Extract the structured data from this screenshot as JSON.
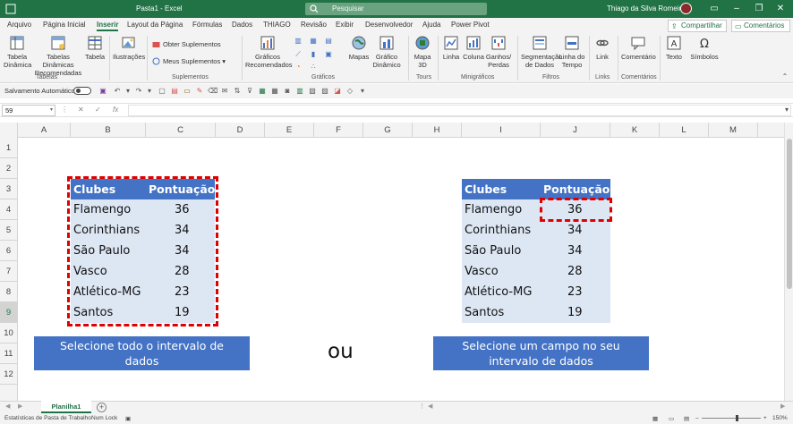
{
  "titlebar": {
    "doc_title": "Pasta1 - Excel",
    "search_placeholder": "Pesquisar",
    "user_name": "Thiago da Silva Romeiro"
  },
  "tabs": [
    "Arquivo",
    "Página Inicial",
    "Inserir",
    "Layout da Página",
    "Fórmulas",
    "Dados",
    "THIAGO",
    "Revisão",
    "Exibir",
    "Desenvolvedor",
    "Ajuda",
    "Power Pivot"
  ],
  "active_tab": "Inserir",
  "share_label": "Compartilhar",
  "comments_label": "Comentários",
  "ribbon": {
    "tabela_dinamica": "Tabela Dinâmica",
    "tabelas_dinamicas_recomendadas": "Tabelas Dinâmicas Recomendadas",
    "tabela": "Tabela",
    "group_tabelas": "Tabelas",
    "ilustracoes": "Ilustrações",
    "obter_suplementos": "Obter Suplementos",
    "meus_suplementos": "Meus Suplementos",
    "group_suplementos": "Suplementos",
    "graficos_recomendados": "Gráficos Recomendados",
    "mapas": "Mapas",
    "grafico_dinamico": "Gráfico Dinâmico",
    "group_graficos": "Gráficos",
    "mapa_3d": "Mapa 3D",
    "group_tours": "Tours",
    "linha": "Linha",
    "coluna": "Coluna",
    "ganhos_perdas": "Ganhos/ Perdas",
    "group_minigraficos": "Minigráficos",
    "segmentacao_de_dados": "Segmentação de Dados",
    "linha_do_tempo": "Linha do Tempo",
    "group_filtros": "Filtros",
    "link": "Link",
    "group_links": "Links",
    "comentario": "Comentário",
    "group_comentarios": "Comentários",
    "texto": "Texto",
    "simbolos": "Símbolos"
  },
  "quick_access": {
    "autosave_label": "Salvamento Automático"
  },
  "formula_bar": {
    "name_box": "59",
    "fx": "fx",
    "formula": ""
  },
  "columns": [
    "A",
    "B",
    "C",
    "D",
    "E",
    "F",
    "G",
    "H",
    "I",
    "J",
    "K",
    "L",
    "M"
  ],
  "rows": [
    "1",
    "2",
    "3",
    "4",
    "5",
    "6",
    "7",
    "8",
    "9",
    "10",
    "11",
    "12"
  ],
  "table_left": {
    "header": [
      "Clubes",
      "Pontuação"
    ],
    "rows": [
      [
        "Flamengo",
        "36"
      ],
      [
        "Corinthians",
        "34"
      ],
      [
        "São Paulo",
        "34"
      ],
      [
        "Vasco",
        "28"
      ],
      [
        "Atlético-MG",
        "23"
      ],
      [
        "Santos",
        "19"
      ]
    ]
  },
  "table_right": {
    "header": [
      "Clubes",
      "Pontuação"
    ],
    "rows": [
      [
        "Flamengo",
        "36"
      ],
      [
        "Corinthians",
        "34"
      ],
      [
        "São Paulo",
        "34"
      ],
      [
        "Vasco",
        "28"
      ],
      [
        "Atlético-MG",
        "23"
      ],
      [
        "Santos",
        "19"
      ]
    ]
  },
  "callout_left": "Selecione todo o intervalo de dados",
  "callout_right": "Selecione um campo no seu intervalo de dados",
  "ou_label": "ou",
  "sheet_tab": "Planilha1",
  "statusbar": {
    "estatisticas": "Estatísticas de Pasta de Trabalho",
    "num_lock": "Num Lock",
    "zoom": "150%"
  },
  "colors": {
    "excel_green": "#217346",
    "table_header_blue": "#4472c4",
    "table_body_blue": "#dde7f4",
    "selection_dash_red": "#e00000"
  }
}
